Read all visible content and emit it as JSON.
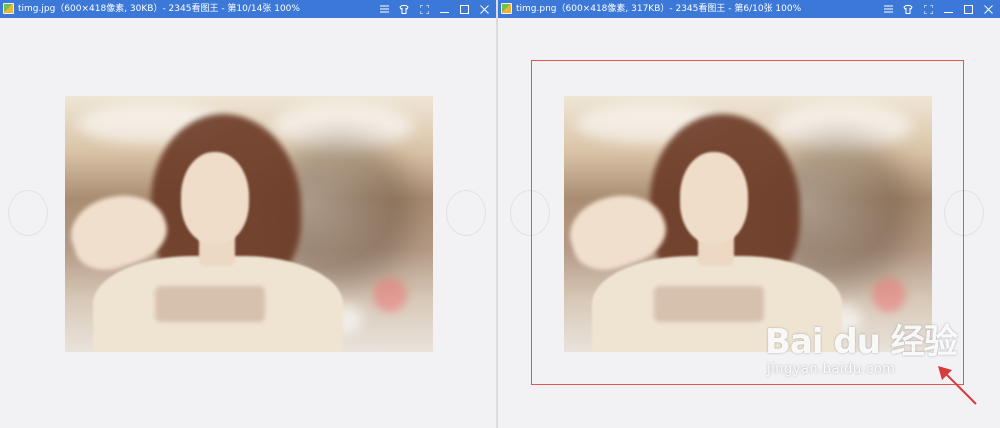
{
  "windows": [
    {
      "title": "timg.jpg（600×418像素, 30KB）- 2345看图王 - 第10/14张 100%",
      "controls": [
        "menu-icon",
        "skin-icon",
        "fullscreen-icon",
        "minimize-icon",
        "maximize-icon",
        "close-icon"
      ]
    },
    {
      "title": "timg.png（600×418像素, 317KB）- 2345看图王 - 第6/10张 100%",
      "controls": [
        "menu-icon",
        "skin-icon",
        "fullscreen-icon",
        "minimize-icon",
        "maximize-icon",
        "close-icon"
      ]
    }
  ],
  "watermark": {
    "logo": "Bai du 经验",
    "url": "jingyan.baidu.com"
  },
  "colors": {
    "titlebar": "#3c78d8",
    "highlight": "#e05555",
    "viewer_bg": "#f2f1f4"
  }
}
